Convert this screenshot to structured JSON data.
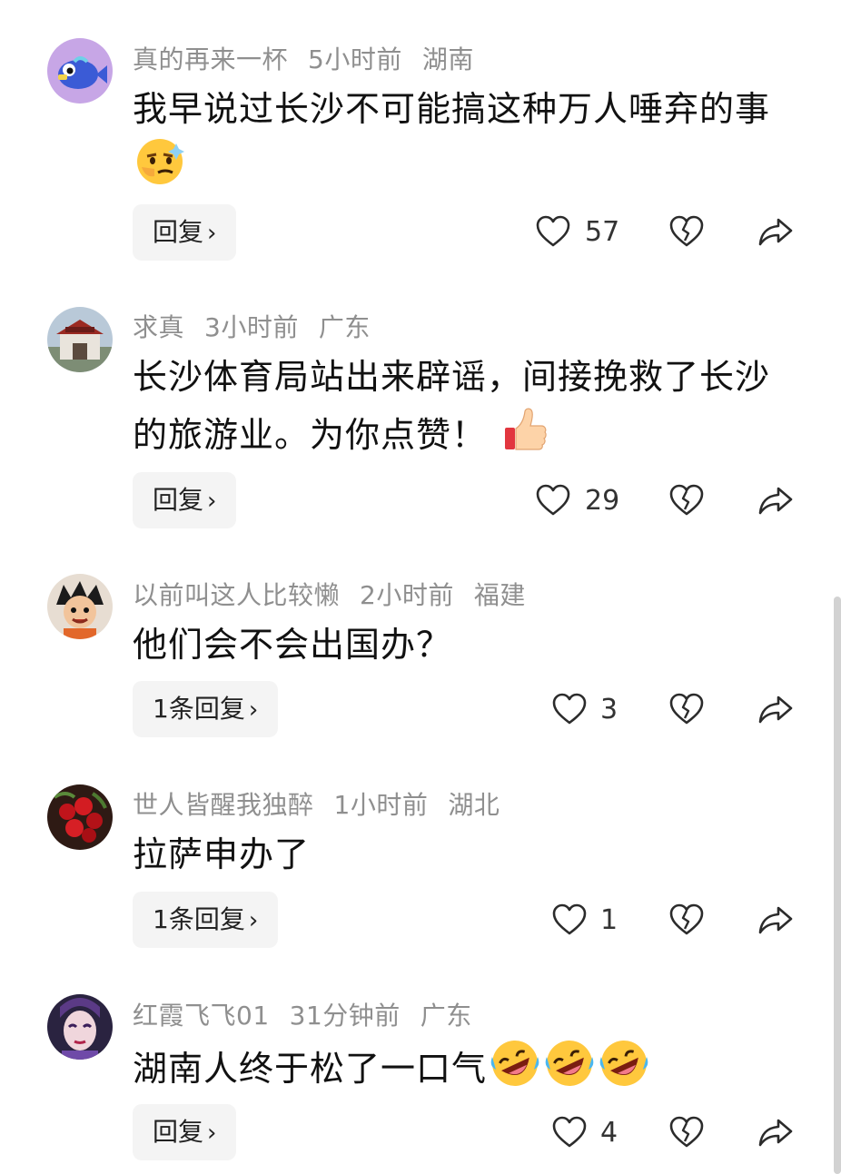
{
  "comments": [
    {
      "username": "真的再来一杯",
      "time": "5小时前",
      "location": "湖南",
      "text": "我早说过长沙不可能搞这种万人唾弃的事",
      "emoji": [
        "smirk-face-emoji"
      ],
      "reply_label": "回复",
      "likes": "57"
    },
    {
      "username": "求真",
      "time": "3小时前",
      "location": "广东",
      "text": "长沙体育局站出来辟谣，间接挽救了长沙的旅游业。为你点赞！",
      "emoji": [
        "thumbs-up-emoji"
      ],
      "reply_label": "回复",
      "likes": "29"
    },
    {
      "username": "以前叫这人比较懒",
      "time": "2小时前",
      "location": "福建",
      "text": "他们会不会出国办？",
      "emoji": [],
      "reply_label": "1条回复",
      "likes": "3"
    },
    {
      "username": "世人皆醒我独醉",
      "time": "1小时前",
      "location": "湖北",
      "text": "拉萨申办了",
      "emoji": [],
      "reply_label": "1条回复",
      "likes": "1"
    },
    {
      "username": "红霞飞飞01",
      "time": "31分钟前",
      "location": "广东",
      "text": "湖南人终于松了一口气",
      "emoji": [
        "rofl-face-emoji",
        "rofl-face-emoji",
        "rofl-face-emoji"
      ],
      "reply_label": "回复",
      "likes": "4"
    }
  ],
  "colors": {
    "meta": "#8f8f8f",
    "text": "#111111",
    "reply_bg": "#f4f4f4",
    "icon": "#2b2b2b"
  }
}
